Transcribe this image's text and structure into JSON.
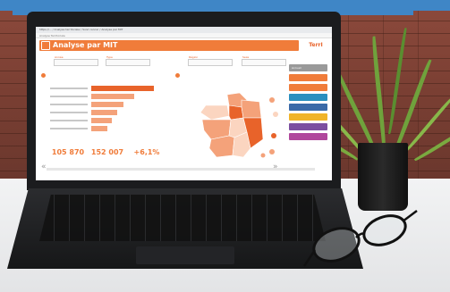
{
  "app": {
    "title": "Analyse par MIT",
    "brand": "TerrI",
    "browser_url": "https://... / Analyse territoriale / Suivi cancer / Analyse par MIT",
    "header_text": "Analyse Territoriale"
  },
  "filters": [
    {
      "label": "Année"
    },
    {
      "label": "Type"
    },
    {
      "label": "Région"
    },
    {
      "label": "Sexe"
    }
  ],
  "chart_data": {
    "type": "bar",
    "orientation": "horizontal",
    "title": "",
    "categories": [
      "",
      "",
      "",
      "",
      "",
      ""
    ],
    "values": [
      70,
      48,
      36,
      29,
      23,
      18
    ],
    "xlim": [
      0,
      80
    ],
    "grid": false
  },
  "kpis": [
    {
      "label": "",
      "value": "105 870"
    },
    {
      "label": "",
      "value": "152 007"
    },
    {
      "label": "",
      "value": "+6,1%"
    }
  ],
  "side_buttons": [
    {
      "label": "Accueil",
      "color": "#9a9a9a"
    },
    {
      "label": "",
      "color": "#f07c3a"
    },
    {
      "label": "",
      "color": "#f07c3a"
    },
    {
      "label": "",
      "color": "#2a8fbf"
    },
    {
      "label": "",
      "color": "#3a6aa8"
    },
    {
      "label": "",
      "color": "#f0b429"
    },
    {
      "label": "",
      "color": "#7c4fa0"
    },
    {
      "label": "",
      "color": "#b0479c"
    }
  ],
  "nav": {
    "prev_icon": "«",
    "next_icon": "»"
  },
  "colors": {
    "accent": "#f07c3a",
    "map_dark": "#e8632a",
    "map_mid": "#f4a27a",
    "map_light": "#fbd5c0"
  }
}
